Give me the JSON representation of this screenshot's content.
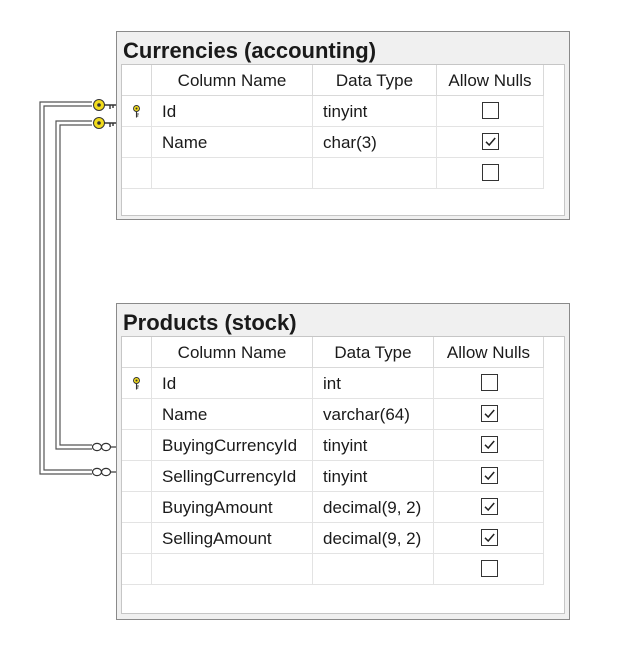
{
  "column_headers": [
    "Column Name",
    "Data Type",
    "Allow Nulls"
  ],
  "tables": {
    "currencies": {
      "title": "Currencies (accounting)",
      "rows": [
        {
          "name": "Id",
          "type": "tinyint",
          "allow_nulls": false,
          "primary_key": true
        },
        {
          "name": "Name",
          "type": "char(3)",
          "allow_nulls": true,
          "primary_key": false
        },
        {
          "name": "",
          "type": "",
          "allow_nulls": false,
          "primary_key": false
        }
      ]
    },
    "products": {
      "title": "Products (stock)",
      "rows": [
        {
          "name": "Id",
          "type": "int",
          "allow_nulls": false,
          "primary_key": true
        },
        {
          "name": "Name",
          "type": "varchar(64)",
          "allow_nulls": true,
          "primary_key": false
        },
        {
          "name": "BuyingCurrencyId",
          "type": "tinyint",
          "allow_nulls": true,
          "primary_key": false
        },
        {
          "name": "SellingCurrencyId",
          "type": "tinyint",
          "allow_nulls": true,
          "primary_key": false
        },
        {
          "name": "BuyingAmount",
          "type": "decimal(9, 2)",
          "allow_nulls": true,
          "primary_key": false
        },
        {
          "name": "SellingAmount",
          "type": "decimal(9, 2)",
          "allow_nulls": true,
          "primary_key": false
        },
        {
          "name": "",
          "type": "",
          "allow_nulls": false,
          "primary_key": false
        }
      ]
    }
  },
  "relationships": [
    {
      "from": "Products.BuyingCurrencyId",
      "to": "Currencies.Id",
      "one_end": "key-icon",
      "many_end": "infinity-icon"
    },
    {
      "from": "Products.SellingCurrencyId",
      "to": "Currencies.Id",
      "one_end": "key-icon",
      "many_end": "infinity-icon"
    }
  ],
  "colors": {
    "key_icon": "#f2dc1c",
    "line": "#555555",
    "checkmark": "#222222"
  }
}
